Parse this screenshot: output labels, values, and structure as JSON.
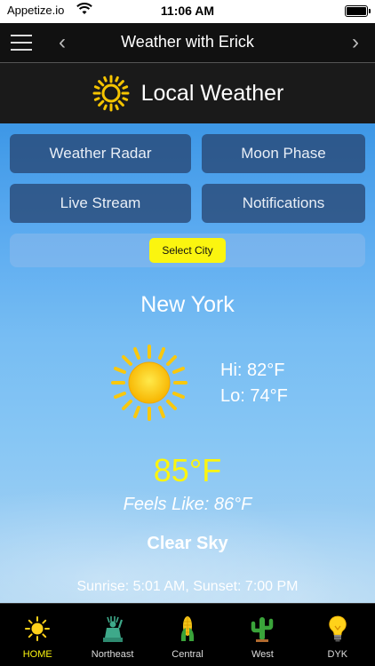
{
  "status_bar": {
    "carrier": "Appetize.io",
    "time": "11:06 AM"
  },
  "nav": {
    "title": "Weather with Erick"
  },
  "header": {
    "title": "Local Weather"
  },
  "buttons": {
    "weather_radar": "Weather Radar",
    "moon_phase": "Moon Phase",
    "live_stream": "Live Stream",
    "notifications": "Notifications",
    "select_city": "Select City"
  },
  "weather": {
    "city": "New York",
    "hi": "Hi: 82°F",
    "lo": "Lo: 74°F",
    "temp": "85°F",
    "feels_like": "Feels Like: 86°F",
    "condition": "Clear Sky",
    "sun_times": "Sunrise: 5:01 AM, Sunset: 7:00 PM"
  },
  "tabs": [
    {
      "label": "HOME",
      "icon": "sun-icon",
      "active": true
    },
    {
      "label": "Northeast",
      "icon": "statue-of-liberty-icon",
      "active": false
    },
    {
      "label": "Central",
      "icon": "corn-icon",
      "active": false
    },
    {
      "label": "West",
      "icon": "cactus-icon",
      "active": false
    },
    {
      "label": "DYK",
      "icon": "lightbulb-icon",
      "active": false
    }
  ],
  "colors": {
    "accent": "#fbf50f",
    "sky_top": "#3d97e6",
    "sky_bottom": "#a9d3f1",
    "button_bg": "#28467a"
  }
}
